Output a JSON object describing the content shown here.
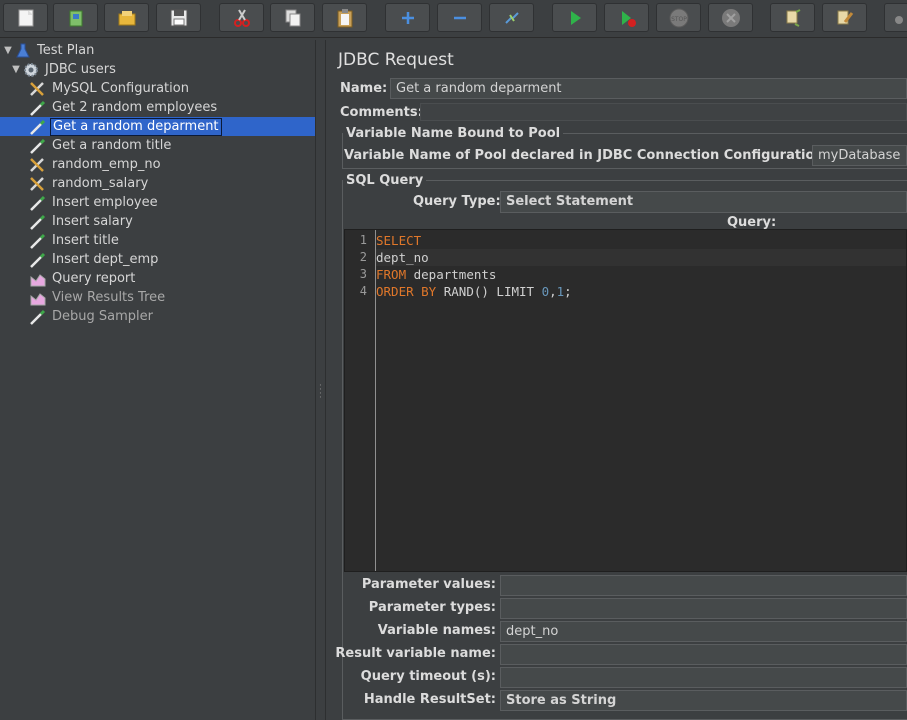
{
  "toolbar": {
    "buttons": [
      {
        "name": "new-button",
        "icon": "new-document-icon"
      },
      {
        "name": "templates-button",
        "icon": "templates-icon"
      },
      {
        "name": "open-button",
        "icon": "open-folder-icon"
      },
      {
        "name": "save-button",
        "icon": "floppy-disk-icon"
      },
      {
        "name": "cut-button",
        "icon": "scissors-icon"
      },
      {
        "name": "copy-button",
        "icon": "copy-icon"
      },
      {
        "name": "paste-button",
        "icon": "clipboard-icon"
      },
      {
        "name": "expand-all-button",
        "icon": "plus-icon"
      },
      {
        "name": "collapse-all-button",
        "icon": "minus-icon"
      },
      {
        "name": "toggle-button",
        "icon": "toggle-icon"
      },
      {
        "name": "start-button",
        "icon": "play-icon"
      },
      {
        "name": "start-no-pauses-button",
        "icon": "play-no-pause-icon"
      },
      {
        "name": "stop-button",
        "icon": "stop-icon"
      },
      {
        "name": "shutdown-button",
        "icon": "shutdown-icon"
      },
      {
        "name": "clear-button",
        "icon": "broom-icon"
      },
      {
        "name": "clear-all-button",
        "icon": "broom-all-icon"
      },
      {
        "name": "search-button",
        "icon": "binoculars-icon"
      }
    ]
  },
  "tree": {
    "items": [
      {
        "label": "Test Plan",
        "icon": "flask-icon",
        "level": 0,
        "expanded": true
      },
      {
        "label": "JDBC users",
        "icon": "gear-icon",
        "level": 1,
        "expanded": true
      },
      {
        "label": "MySQL Configuration",
        "icon": "wrench-scissors-icon",
        "level": 2
      },
      {
        "label": "Get 2 random employees",
        "icon": "pipette-icon",
        "level": 2
      },
      {
        "label": "Get a random deparment",
        "icon": "pipette-icon",
        "level": 2,
        "selected": true
      },
      {
        "label": "Get a random title",
        "icon": "pipette-icon",
        "level": 2
      },
      {
        "label": "random_emp_no",
        "icon": "wrench-scissors-icon",
        "level": 2
      },
      {
        "label": "random_salary",
        "icon": "wrench-scissors-icon",
        "level": 2
      },
      {
        "label": "Insert employee",
        "icon": "pipette-icon",
        "level": 2
      },
      {
        "label": "Insert salary",
        "icon": "pipette-icon",
        "level": 2
      },
      {
        "label": "Insert title",
        "icon": "pipette-icon",
        "level": 2
      },
      {
        "label": "Insert dept_emp",
        "icon": "pipette-icon",
        "level": 2
      },
      {
        "label": "Query report",
        "icon": "chart-icon",
        "level": 2
      },
      {
        "label": "View Results Tree",
        "icon": "chart-icon",
        "level": 2,
        "disabled": true
      },
      {
        "label": "Debug Sampler",
        "icon": "pipette-icon",
        "level": 2,
        "disabled": true
      }
    ]
  },
  "panel": {
    "title": "JDBC Request",
    "name_label": "Name:",
    "name_value": "Get a random deparment",
    "comments_label": "Comments:",
    "pool_group_title": "Variable Name Bound to Pool",
    "pool_label": "Variable Name of Pool declared in JDBC Connection Configuration:",
    "pool_value": "myDatabase",
    "sql_group_title": "SQL Query",
    "query_type_label": "Query Type:",
    "query_type_value": "Select Statement",
    "query_label": "Query:",
    "code": {
      "line_numbers": [
        "1",
        "2",
        "3",
        "4"
      ],
      "lines": [
        {
          "tokens": [
            {
              "t": "SELECT",
              "k": "kw"
            }
          ]
        },
        {
          "tokens": [
            {
              "t": "dept_no",
              "k": ""
            }
          ]
        },
        {
          "tokens": [
            {
              "t": "FROM",
              "k": "kw"
            },
            {
              "t": " departments",
              "k": ""
            }
          ]
        },
        {
          "tokens": [
            {
              "t": "ORDER BY",
              "k": "kw"
            },
            {
              "t": " RAND() LIMIT ",
              "k": ""
            },
            {
              "t": "0",
              "k": "num"
            },
            {
              "t": ",",
              "k": ""
            },
            {
              "t": "1",
              "k": "num"
            },
            {
              "t": ";",
              "k": ""
            }
          ]
        }
      ]
    },
    "params": [
      {
        "label": "Parameter values:",
        "value": "",
        "combo": false
      },
      {
        "label": "Parameter types:",
        "value": "",
        "combo": false
      },
      {
        "label": "Variable names:",
        "value": "dept_no",
        "combo": false
      },
      {
        "label": "Result variable name:",
        "value": "",
        "combo": false
      },
      {
        "label": "Query timeout (s):",
        "value": "",
        "combo": false
      },
      {
        "label": "Handle ResultSet:",
        "value": "Store as String",
        "combo": true
      }
    ]
  },
  "colors": {
    "background": "#3c3f41",
    "selection": "#2f65ca",
    "keyword": "#e0772a",
    "number": "#6897bb",
    "editor_bg": "#2b2b2b"
  }
}
